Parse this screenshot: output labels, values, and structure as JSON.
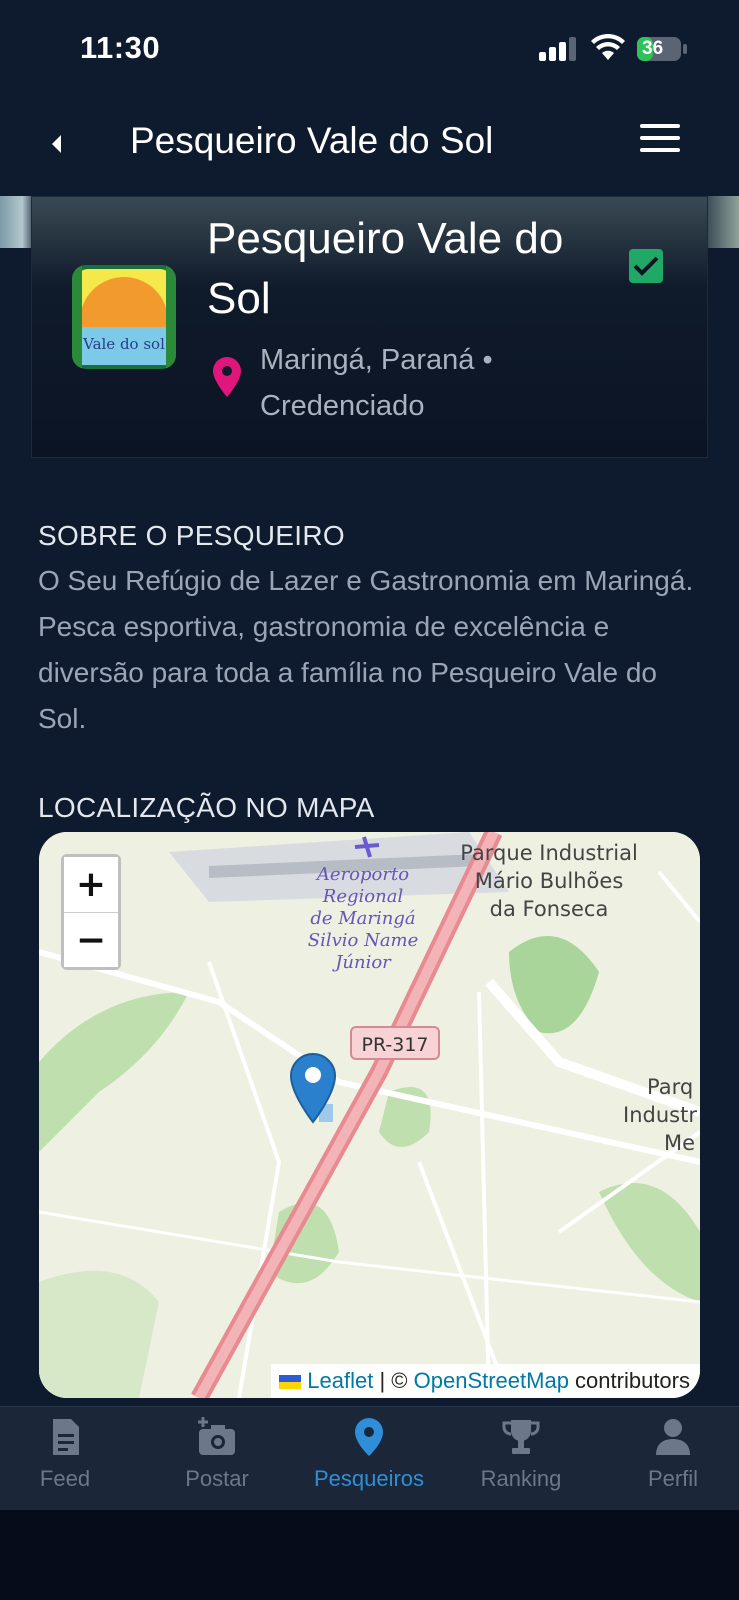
{
  "status_bar": {
    "time": "11:30",
    "battery": "36"
  },
  "header": {
    "title": "Pesqueiro Vale do Sol"
  },
  "hero": {
    "name": "Pesqueiro Vale do Sol",
    "location_line1": "Maringá, Paraná •",
    "location_line2": "Credenciado",
    "logo_text": "Vale do sol"
  },
  "about": {
    "heading": "SOBRE O PESQUEIRO",
    "text": "O Seu Refúgio de Lazer e Gastronomia em Maringá. Pesca esportiva, gastronomia de excelência e diversão para toda a família no Pesqueiro Vale do Sol."
  },
  "map_section": {
    "heading": "LOCALIZAÇÃO NO MAPA",
    "zoom_in": "+",
    "zoom_out": "−",
    "labels": {
      "airport": [
        "Aeroporto",
        "Regional",
        "de Maringá",
        "Silvio Name",
        "Júnior"
      ],
      "park1": [
        "Parque Industrial",
        "Mário Bulhões",
        "da Fonseca"
      ],
      "park2": [
        "Parq",
        "Industr",
        "Me"
      ],
      "road": "PR-317"
    },
    "attribution": {
      "leaflet": "Leaflet",
      "sep": " | © ",
      "osm": "OpenStreetMap",
      "rest": " contributors"
    }
  },
  "tabs": [
    {
      "label": "Feed",
      "icon": "feed-icon"
    },
    {
      "label": "Postar",
      "icon": "camera-plus-icon"
    },
    {
      "label": "Pesqueiros",
      "icon": "map-pin-icon",
      "active": true
    },
    {
      "label": "Ranking",
      "icon": "trophy-icon"
    },
    {
      "label": "Perfil",
      "icon": "user-icon"
    }
  ],
  "colors": {
    "accent": "#2e8fd8",
    "check": "#1fa866",
    "pin": "#e0167c",
    "background": "#0e1a2e"
  }
}
